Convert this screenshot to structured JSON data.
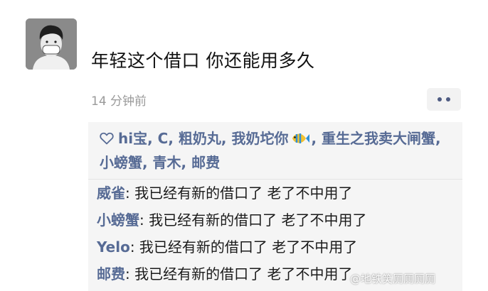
{
  "post": {
    "avatar_icon": "masked-person-avatar-icon",
    "text": "年轻这个借口 你还能用多久",
    "timestamp": "14 分钟前",
    "more_icon": "ellipsis-icon"
  },
  "likes": {
    "icon": "heart-outline-icon",
    "names_before_emoji": "hi宝, C, 粗奶丸, 我奶坨你",
    "emoji": "tropical-fish-icon",
    "names_after_emoji": ", 重生之我卖大闸蟹, 小螃蟹, 青木, 邮费"
  },
  "comments": [
    {
      "author": "威雀",
      "separator": ": ",
      "content": "我已经有新的借口了 老了不中用了"
    },
    {
      "author": "小螃蟹",
      "separator": ": ",
      "content": "我已经有新的借口了 老了不中用了"
    },
    {
      "author": "Yelo",
      "separator": ": ",
      "content": "我已经有新的借口了 老了不中用了"
    },
    {
      "author": "邮费",
      "separator": ": ",
      "content": "我已经有新的借口了 老了不中用了"
    }
  ],
  "watermark": "@地铁笑厕厕厕厕",
  "colors": {
    "name_link": "#576b95",
    "timestamp": "#9a9a9a",
    "interaction_bg": "#f5f5f5"
  }
}
